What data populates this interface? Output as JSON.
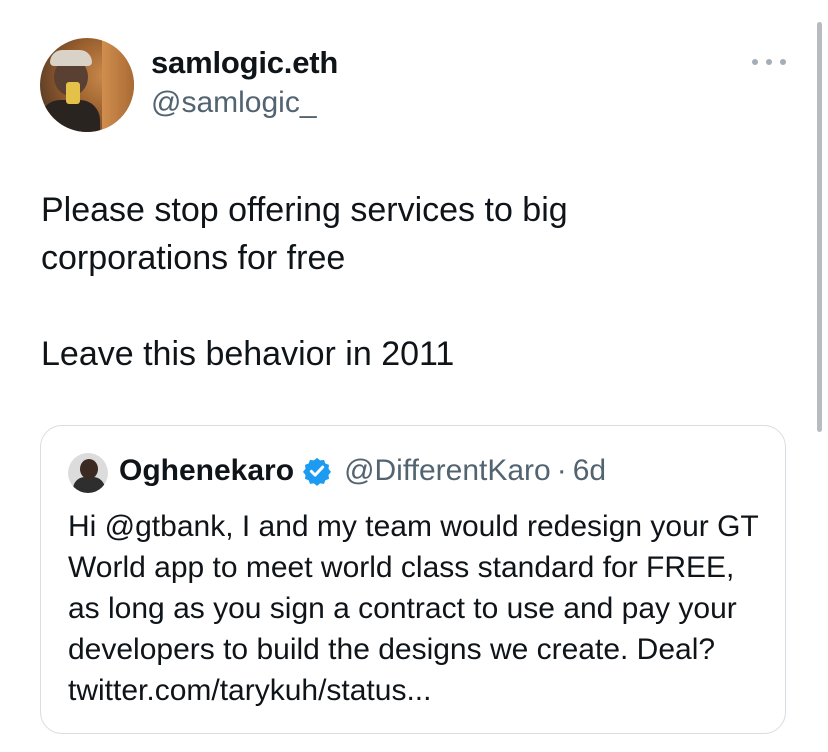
{
  "tweet": {
    "author": {
      "display_name": "samlogic.eth",
      "handle": "@samlogic_"
    },
    "text": "Please stop offering services to big\ncorporations for free\n\nLeave this behavior in 2011",
    "more_icon": "more-horizontal-icon"
  },
  "quoted_tweet": {
    "author": {
      "display_name": "Oghenekaro",
      "handle": "@DifferentKaro",
      "verified": true
    },
    "separator": "·",
    "time": "6d",
    "text": "Hi @gtbank, I and my team would redesign your GT World app to meet world class standard for FREE, as long as you sign a contract to use and pay your developers to build the designs we create. Deal? twitter.com/tarykuh/status..."
  },
  "colors": {
    "text": "#0f1419",
    "secondary": "#536471",
    "verified": "#1d9bf0",
    "border": "#d7dde2"
  }
}
